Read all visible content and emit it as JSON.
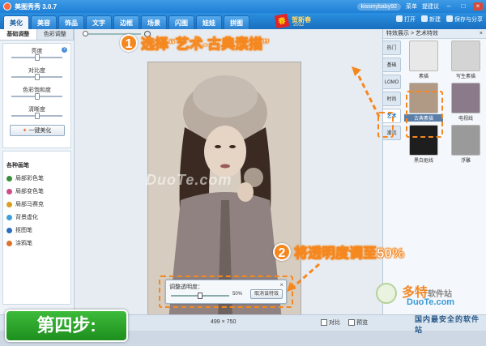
{
  "window": {
    "title": "美图秀秀 3.0.7",
    "user": "kissmybaby92",
    "links": [
      "菜单",
      "提建议"
    ]
  },
  "main_tabs": [
    "美化",
    "美容",
    "饰品",
    "文字",
    "边框",
    "场景",
    "闪图",
    "娃娃",
    "拼图"
  ],
  "banner": {
    "stamp": "春",
    "text": "贺新春",
    "year": "2012"
  },
  "top_actions": {
    "open": "打开",
    "new": "新建",
    "save": "保存与分享"
  },
  "left_panel": {
    "tabs": [
      "基础调整",
      "色彩调整"
    ],
    "sliders": [
      {
        "label": "亮度",
        "value": 0.5
      },
      {
        "label": "对比度",
        "value": 0.5
      },
      {
        "label": "色彩饱和度",
        "value": 0.5
      },
      {
        "label": "清晰度",
        "value": 0.5
      }
    ],
    "auto_button": "一键美化",
    "brushes_title": "各种画笔",
    "brushes": [
      {
        "label": "局部彩色笔",
        "color": "#3b8e3b"
      },
      {
        "label": "局部变色笔",
        "color": "#d04a8a"
      },
      {
        "label": "局部马赛克",
        "color": "#d8a020"
      },
      {
        "label": "背景虚化",
        "color": "#3ba0d8"
      },
      {
        "label": "抠图笔",
        "color": "#2a6fbf"
      },
      {
        "label": "涂鸦笔",
        "color": "#e0702a"
      }
    ]
  },
  "right_panel": {
    "header": "特效展示 > 艺术特效",
    "close": "×",
    "categories": [
      "热门",
      "基础",
      "LOMO",
      "时尚",
      "艺术",
      "潮流"
    ],
    "active_category": 4,
    "effects": [
      {
        "label": "素描",
        "tone": "#e8e8e8"
      },
      {
        "label": "写生素描",
        "tone": "#d4d4d4"
      },
      {
        "label": "古典素描",
        "tone": "#b09a86"
      },
      {
        "label": "电视线",
        "tone": "#8a7a8a"
      },
      {
        "label": "黑白抠线",
        "tone": "#1e1e1e"
      },
      {
        "label": "浮雕",
        "tone": "#9a9a9a"
      }
    ],
    "selected_effect": 2
  },
  "dialog": {
    "label": "调整透明度：",
    "value_pct": 50,
    "value_text": "50%",
    "cancel": "取消该特效",
    "close": "×"
  },
  "canvas": {
    "watermark": "DuoTe.com"
  },
  "statusbar": {
    "dims": "499 × 750",
    "compare": "对比",
    "preview": "预览"
  },
  "annotations": [
    {
      "number": "1",
      "text": "选择“艺术-古典素描”"
    },
    {
      "number": "2",
      "text": "将透明度调至50%"
    }
  ],
  "step_badge": "第四步:",
  "site_logo": {
    "cn": "多特",
    "cn_small": "软件站",
    "en": "DuoTe.com",
    "sub": "国内最安全的软件站"
  },
  "colors": {
    "accent": "#f5871f",
    "title_blue": "#1e7fd6",
    "step_green": "#2aa52a"
  }
}
